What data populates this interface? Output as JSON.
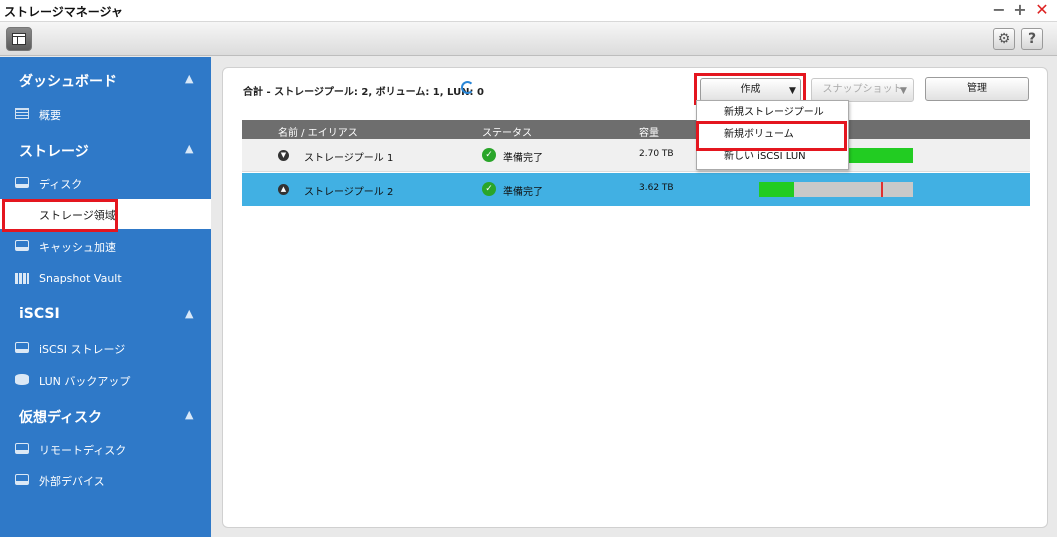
{
  "window": {
    "title": "ストレージマネージャ",
    "minimize": "−",
    "maximize": "+",
    "close": "✕"
  },
  "toolbar": {
    "gear": "⚙",
    "help": "?"
  },
  "sidebar": {
    "sections": [
      {
        "label": "ダッシュボード",
        "chevron": "▲"
      },
      {
        "label": "ストレージ",
        "chevron": "▲"
      },
      {
        "label": "iSCSI",
        "chevron": "▲"
      },
      {
        "label": "仮想ディスク",
        "chevron": "▲"
      }
    ],
    "items": [
      {
        "label": "概要",
        "icon": "list-icon"
      },
      {
        "label": "ディスク",
        "icon": "disk-icon"
      },
      {
        "label": "ストレージ領域",
        "icon": "storage-lines-icon"
      },
      {
        "label": "キャッシュ加速",
        "icon": "cache-disk-icon"
      },
      {
        "label": "Snapshot Vault",
        "icon": "grid-icon"
      },
      {
        "label": "iSCSI ストレージ",
        "icon": "iscsi-disk-icon"
      },
      {
        "label": "LUN バックアップ",
        "icon": "database-icon"
      },
      {
        "label": "リモートディスク",
        "icon": "remote-disk-icon"
      },
      {
        "label": "外部デバイス",
        "icon": "external-device-icon"
      }
    ]
  },
  "summary": {
    "text": "合計 - ストレージプール: 2, ボリューム: 1, LUN: 0"
  },
  "buttons": {
    "create": "作成",
    "snapshot": "スナップショット",
    "manage": "管理",
    "caret": "▼"
  },
  "menu": {
    "items": [
      "新規ストレージプール",
      "新規ボリューム",
      "新しい iSCSI LUN"
    ]
  },
  "table": {
    "headers": [
      "名前 / エイリアス",
      "ステータス",
      "容量"
    ],
    "rows": [
      {
        "name": "ストレージプール 1",
        "status": "準備完了",
        "capacity": "2.70 TB",
        "toggle": "▼",
        "used_fraction": 1.0,
        "mark_fraction": null
      },
      {
        "name": "ストレージプール 2",
        "status": "準備完了",
        "capacity": "3.62 TB",
        "toggle": "▲",
        "used_fraction": 0.23,
        "mark_fraction": 0.79
      }
    ]
  },
  "colors": {
    "sidebar": "#2f79c8",
    "selected_row": "#41b0e3",
    "highlight": "#e4161f",
    "bar_fill": "#22cc22"
  }
}
